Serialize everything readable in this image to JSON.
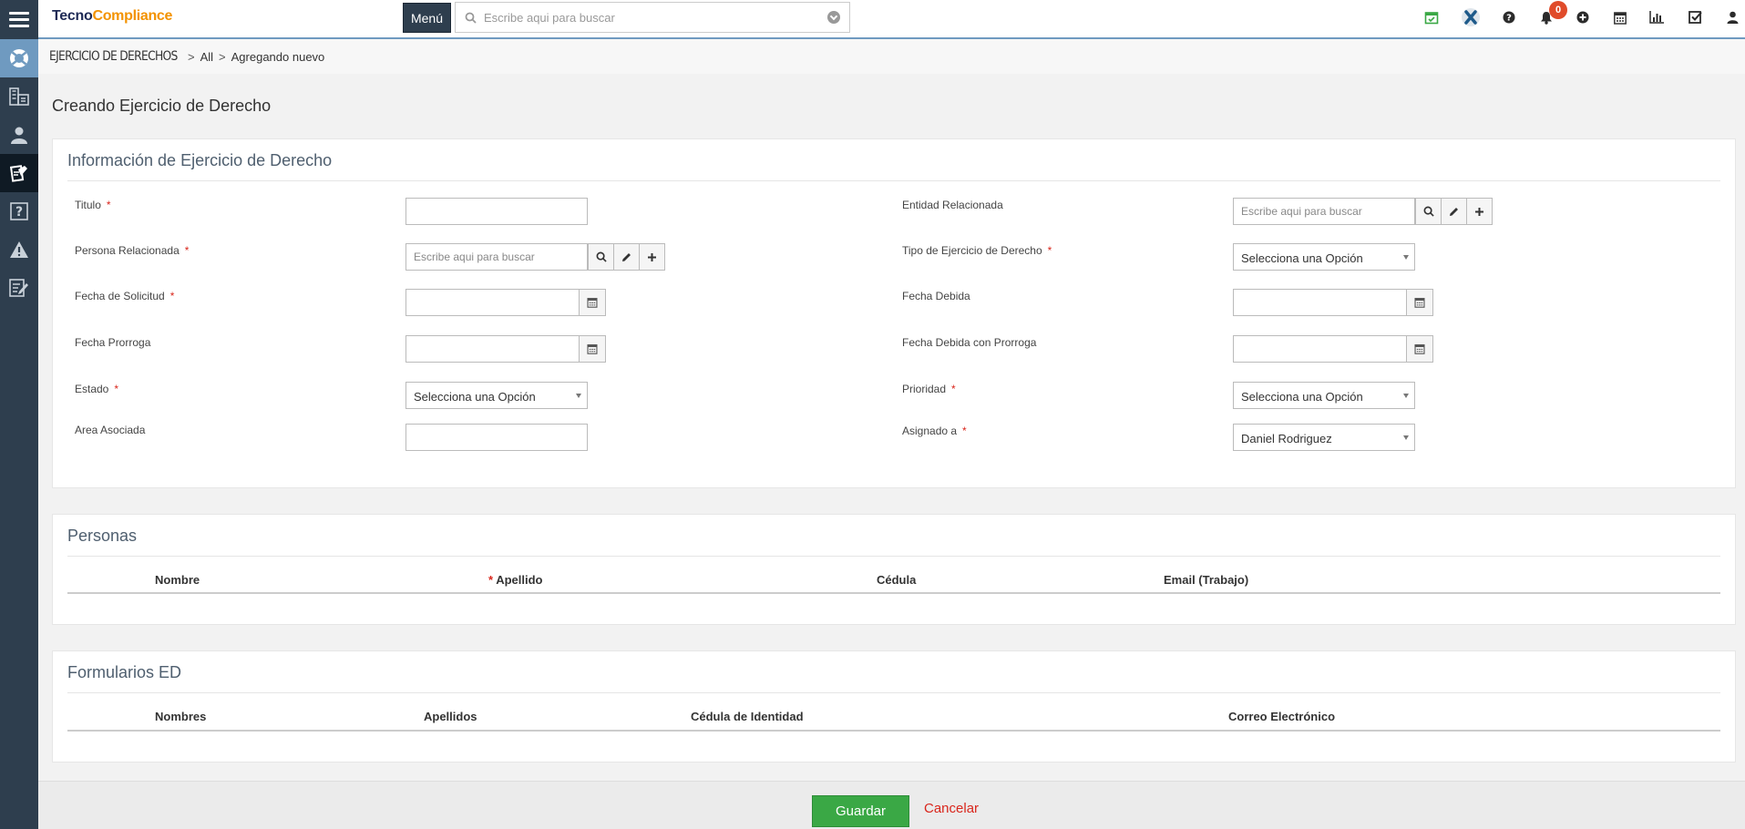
{
  "app": {
    "logo_part1": "Tecno",
    "logo_part2": "Compliance"
  },
  "topbar": {
    "menu_label": "Menú",
    "search_placeholder": "Escribe aqui para buscar",
    "notifications_count": "0"
  },
  "breadcrumb": {
    "root": "EJERCICIO DE DERECHOS",
    "level1": "All",
    "level2": "Agregando nuevo"
  },
  "page_title": "Creando Ejercicio de Derecho",
  "info_section": {
    "title": "Información de Ejercicio de Derecho",
    "titulo_label": "Titulo",
    "persona_label": "Persona Relacionada",
    "persona_placeholder": "Escribe aqui para buscar",
    "fecha_solicitud_label": "Fecha de Solicitud",
    "fecha_prorroga_label": "Fecha Prorroga",
    "estado_label": "Estado",
    "estado_value": "Selecciona una Opción",
    "area_label": "Area Asociada",
    "entidad_label": "Entidad Relacionada",
    "entidad_placeholder": "Escribe aqui para buscar",
    "tipo_label": "Tipo de Ejercicio de Derecho",
    "tipo_value": "Selecciona una Opción",
    "fecha_debida_label": "Fecha Debida",
    "fecha_debida_prorroga_label": "Fecha Debida con Prorroga",
    "prioridad_label": "Prioridad",
    "prioridad_value": "Selecciona una Opción",
    "asignado_label": "Asignado a",
    "asignado_value": "Daniel Rodriguez",
    "required_mark": "*"
  },
  "personas_section": {
    "title": "Personas",
    "columns": [
      "Nombre",
      "Apellido",
      "Cédula",
      "Email (Trabajo)"
    ]
  },
  "formularios_section": {
    "title": "Formularios ED",
    "columns": [
      "Nombres",
      "Apellidos",
      "Cédula de Identidad",
      "Correo Electrónico"
    ]
  },
  "footer": {
    "save_label": "Guardar",
    "cancel_label": "Cancelar"
  },
  "colors": {
    "sidebar": "#2e3e4e",
    "accent": "#6f9ac0",
    "save": "#3aa845",
    "required": "#d9261c",
    "brand_orange": "#f39200"
  }
}
